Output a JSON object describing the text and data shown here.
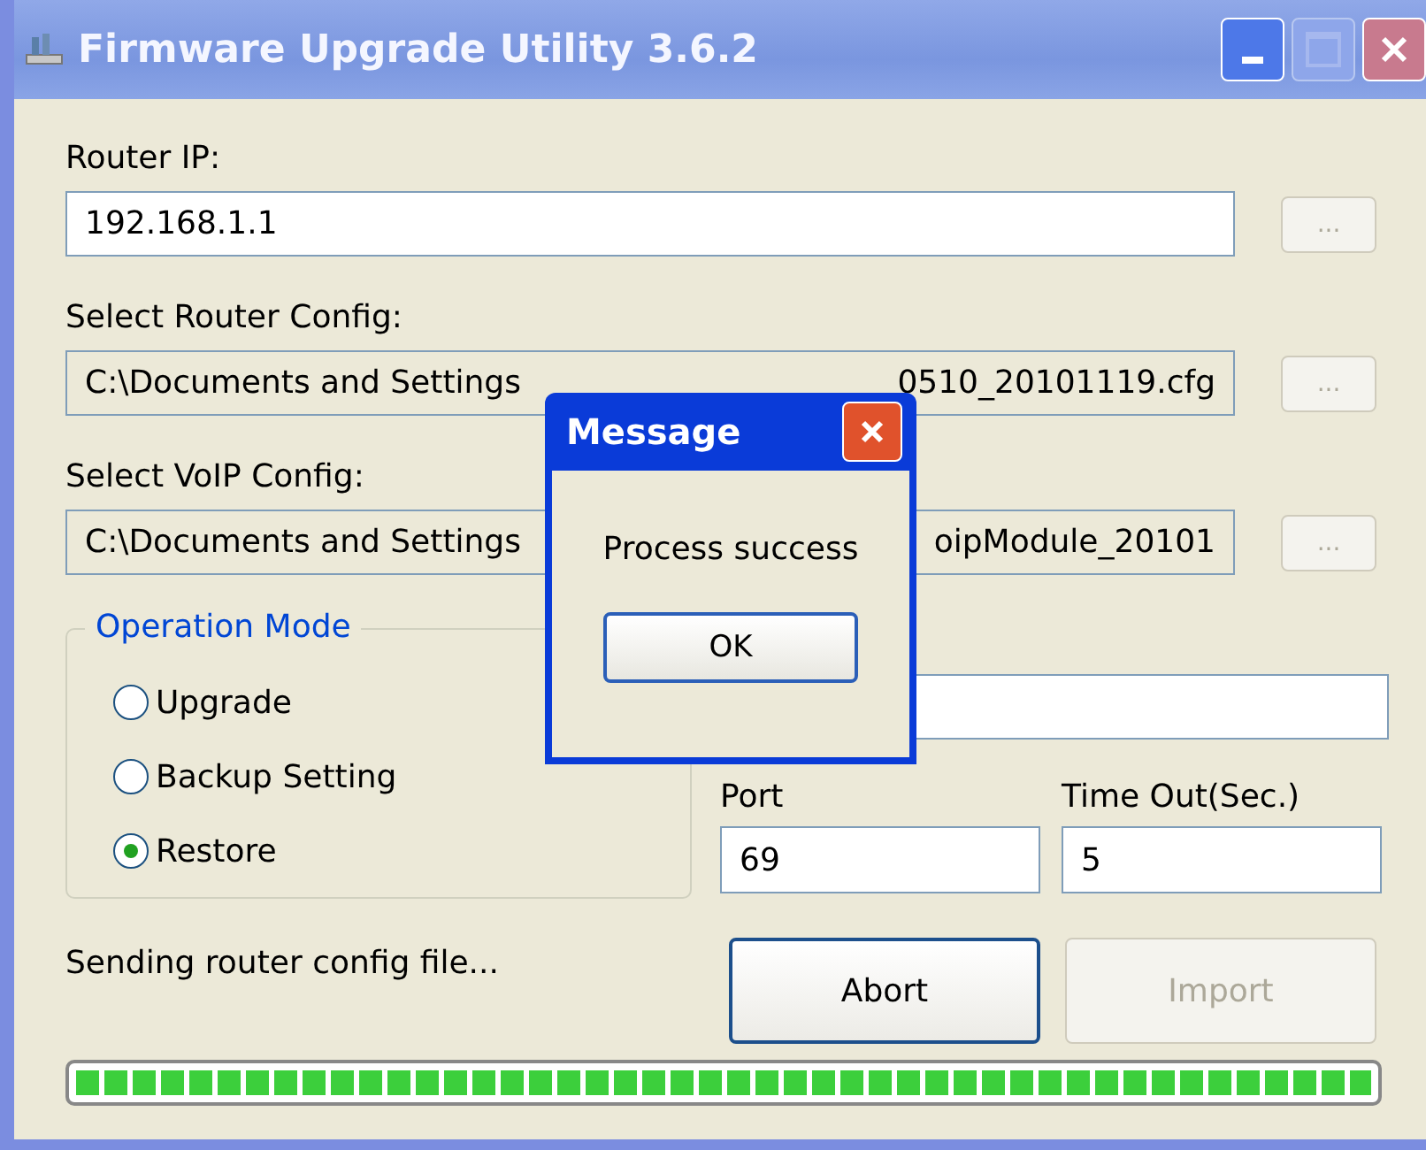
{
  "window": {
    "title": "Firmware Upgrade Utility 3.6.2"
  },
  "router_ip": {
    "label": "Router IP:",
    "value": "192.168.1.1",
    "browse": "...",
    "browse_disabled": true
  },
  "router_config": {
    "label": "Select Router Config:",
    "value_start": "C:\\Documents and Settings",
    "value_end": "0510_20101119.cfg",
    "browse": "...",
    "browse_disabled": true
  },
  "voip_config": {
    "label": "Select VoIP Config:",
    "value_start": "C:\\Documents and Settings",
    "value_end": "oipModule_20101",
    "browse": "...",
    "browse_disabled": true
  },
  "operation_mode": {
    "title": "Operation Mode",
    "options": [
      {
        "label": "Upgrade",
        "selected": false
      },
      {
        "label": "Backup Setting",
        "selected": false
      },
      {
        "label": "Restore",
        "selected": true
      }
    ]
  },
  "port": {
    "label": "Port",
    "value": "69"
  },
  "timeout": {
    "label": "Time Out(Sec.)",
    "value": "5"
  },
  "status": "Sending router config file...",
  "buttons": [
    {
      "label": "Abort",
      "disabled": false
    },
    {
      "label": "Import",
      "disabled": true
    }
  ],
  "progress": {
    "level": 1.0
  },
  "dialog": {
    "title": "Message",
    "message": "Process success",
    "button": "OK"
  }
}
